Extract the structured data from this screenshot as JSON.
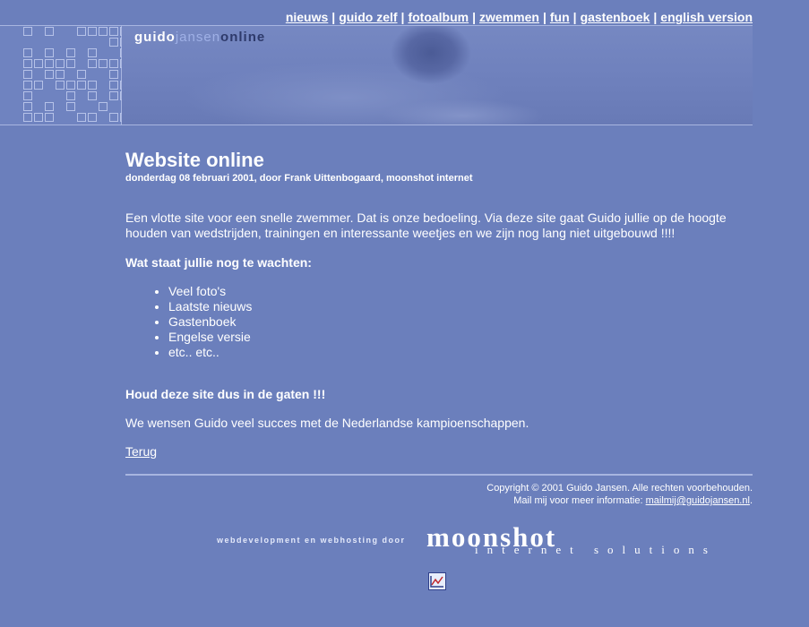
{
  "nav": [
    {
      "label": "nieuws"
    },
    {
      "label": "guido zelf"
    },
    {
      "label": "fotoalbum"
    },
    {
      "label": "zwemmen"
    },
    {
      "label": "fun"
    },
    {
      "label": "gastenboek"
    },
    {
      "label": "english version"
    }
  ],
  "nav_separator": "|",
  "logo": {
    "part1": "guido",
    "part2": "jansen",
    "part3": "online"
  },
  "article": {
    "title": "Website online",
    "byline": "donderdag 08 februari 2001, door Frank Uittenbogaard, moonshot internet",
    "intro": "Een vlotte site voor een snelle zwemmer. Dat is onze bedoeling. Via deze site gaat Guido jullie op de hoogte houden van wedstrijden, trainingen en interessante weetjes en we zijn nog lang niet uitgebouwd !!!!",
    "subhead": "Wat staat jullie nog te wachten:",
    "items": [
      "Veel foto's",
      "Laatste nieuws",
      "Gastenboek",
      "Engelse versie",
      "etc.. etc.."
    ],
    "slogan": "Houd deze site dus in de gaten !!!",
    "wish": "We wensen Guido veel succes met de Nederlandse kampioenschappen.",
    "back": "Terug"
  },
  "footer": {
    "copyright": "Copyright © 2001 Guido Jansen. Alle rechten voorbehouden.",
    "mail_prefix": "Mail mij voor meer informatie: ",
    "mail_link": "mailmij@guidojansen.nl",
    "mail_suffix": "."
  },
  "moonshot": {
    "label": "webdevelopment en webhosting door",
    "name": "moonshot",
    "sub": "internet solutions"
  },
  "colors": {
    "background": "#6b7fbc",
    "text": "#ffffff",
    "divider": "#a8b5e0"
  },
  "icons": {
    "counter": "chart-icon"
  }
}
